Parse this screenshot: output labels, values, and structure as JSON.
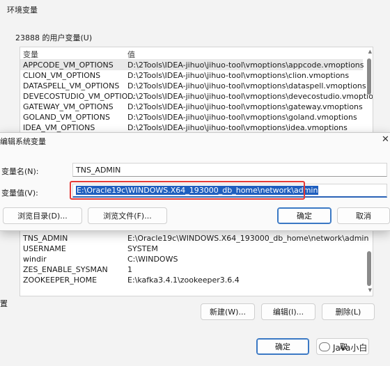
{
  "env_window": {
    "title": "环境变量"
  },
  "user_vars": {
    "label": "23888 的用户变量(U)",
    "col_var": "变量",
    "col_val": "值",
    "rows": [
      {
        "name": "APPCODE_VM_OPTIONS",
        "value": "D:\\2Tools\\IDEA-jihuo\\jihuo-tool\\vmoptions\\appcode.vmoptions"
      },
      {
        "name": "CLION_VM_OPTIONS",
        "value": "D:\\2Tools\\IDEA-jihuo\\jihuo-tool\\vmoptions\\clion.vmoptions"
      },
      {
        "name": "DATASPELL_VM_OPTIONS",
        "value": "D:\\2Tools\\IDEA-jihuo\\jihuo-tool\\vmoptions\\dataspell.vmoptions"
      },
      {
        "name": "DEVECOSTUDIO_VM_OPTIO...",
        "value": "D:\\2Tools\\IDEA-jihuo\\jihuo-tool\\vmoptions\\devecostudio.vmoptions"
      },
      {
        "name": "GATEWAY_VM_OPTIONS",
        "value": "D:\\2Tools\\IDEA-jihuo\\jihuo-tool\\vmoptions\\gateway.vmoptions"
      },
      {
        "name": "GOLAND_VM_OPTIONS",
        "value": "D:\\2Tools\\IDEA-jihuo\\jihuo-tool\\vmoptions\\goland.vmoptions"
      },
      {
        "name": "IDEA_VM_OPTIONS",
        "value": "D:\\2Tools\\IDEA-jihuo\\jihuo-tool\\vmoptions\\idea.vmoptions"
      }
    ]
  },
  "edit_dialog": {
    "title": "编辑系统变量",
    "close": "✕",
    "name_label": "变量名(N):",
    "name_value": "TNS_ADMIN",
    "value_label": "变量值(V):",
    "value_value": "E:\\Oracle19c\\WINDOWS.X64_193000_db_home\\network\\admin",
    "browse_dir": "浏览目录(D)...",
    "browse_file": "浏览文件(F)...",
    "ok": "确定",
    "cancel": "取消"
  },
  "sys_vars": {
    "rows": [
      {
        "name": "TNS_ADMIN",
        "value": "E:\\Oracle19c\\WINDOWS.X64_193000_db_home\\network\\admin"
      },
      {
        "name": "USERNAME",
        "value": "SYSTEM"
      },
      {
        "name": "windir",
        "value": "C:\\WINDOWS"
      },
      {
        "name": "ZES_ENABLE_SYSMAN",
        "value": "1"
      },
      {
        "name": "ZOOKEEPER_HOME",
        "value": "E:\\kafka3.4.1\\zookeeper3.6.4"
      }
    ],
    "new_button": "新建(W)...",
    "edit_button": "编辑(I)...",
    "delete_button": "删除(L)"
  },
  "left_edge_fragment": "置",
  "bottom": {
    "ok": "确定",
    "cancel": "取"
  },
  "watermark": {
    "text": "Java小白",
    "icon": "wechat-icon"
  },
  "colors": {
    "selection": "#1f5fbf",
    "highlight_box": "#e53935",
    "primary_border": "#3a78c4"
  }
}
